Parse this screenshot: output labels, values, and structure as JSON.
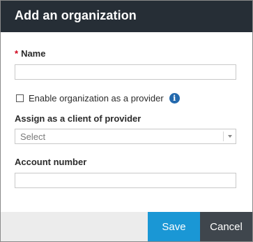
{
  "dialog": {
    "title": "Add an organization"
  },
  "form": {
    "name": {
      "required_marker": "*",
      "label": "Name",
      "value": ""
    },
    "enable_provider": {
      "label": "Enable organization as a provider",
      "checked": false,
      "info_icon": "info-icon",
      "info_glyph": "i"
    },
    "assign_client": {
      "label": "Assign as a client of provider",
      "selected": "Select"
    },
    "account_number": {
      "label": "Account number",
      "value": ""
    }
  },
  "footer": {
    "save_label": "Save",
    "cancel_label": "Cancel"
  },
  "colors": {
    "header_bg": "#262e36",
    "save_bg": "#1a97d5",
    "cancel_bg": "#3f464d",
    "required": "#d0021b",
    "info_icon": "#2369ad"
  }
}
